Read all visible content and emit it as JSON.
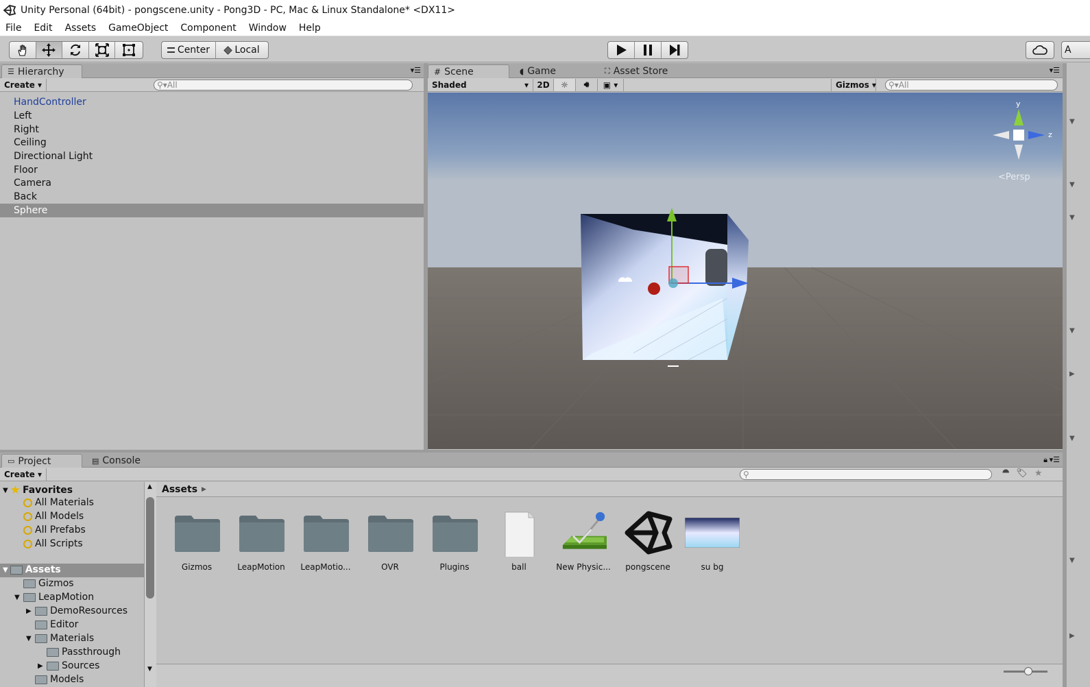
{
  "window": {
    "title": "Unity Personal (64bit) - pongscene.unity - Pong3D - PC, Mac & Linux Standalone* <DX11>"
  },
  "menu": [
    "File",
    "Edit",
    "Assets",
    "GameObject",
    "Component",
    "Window",
    "Help"
  ],
  "toolbar": {
    "pivot_label": "Center",
    "space_label": "Local",
    "partial_right": "A"
  },
  "hierarchy": {
    "tab_label": "Hierarchy",
    "create_label": "Create",
    "search_placeholder": "All",
    "items": [
      "HandController",
      "Left",
      "Right",
      "Ceiling",
      "Directional Light",
      "Floor",
      "Camera",
      "Back",
      "Sphere"
    ],
    "selected_index": 8
  },
  "scene_tabs": {
    "scene": "Scene",
    "game": "Game",
    "asset_store": "Asset Store"
  },
  "scene_toolbar": {
    "shading": "Shaded",
    "mode_2d": "2D",
    "gizmos": "Gizmos",
    "search_placeholder": "All"
  },
  "gizmo": {
    "y_label": "y",
    "z_label": "z",
    "projection": "Persp"
  },
  "bottom_tabs": {
    "project": "Project",
    "console": "Console"
  },
  "project": {
    "create_label": "Create",
    "breadcrumb": "Assets",
    "favorites_label": "Favorites",
    "favorites": [
      "All Materials",
      "All Models",
      "All Prefabs",
      "All Scripts"
    ],
    "assets_root": "Assets",
    "tree": [
      {
        "label": "Gizmos",
        "indent": 1,
        "arrow": ""
      },
      {
        "label": "LeapMotion",
        "indent": 1,
        "arrow": "down"
      },
      {
        "label": "DemoResources",
        "indent": 2,
        "arrow": "right"
      },
      {
        "label": "Editor",
        "indent": 2,
        "arrow": ""
      },
      {
        "label": "Materials",
        "indent": 2,
        "arrow": "down"
      },
      {
        "label": "Passthrough",
        "indent": 3,
        "arrow": ""
      },
      {
        "label": "Sources",
        "indent": 3,
        "arrow": "right"
      },
      {
        "label": "Models",
        "indent": 2,
        "arrow": ""
      }
    ],
    "assets": [
      {
        "label": "Gizmos",
        "kind": "folder"
      },
      {
        "label": "LeapMotion",
        "kind": "folder"
      },
      {
        "label": "LeapMotio...",
        "kind": "folder"
      },
      {
        "label": "OVR",
        "kind": "folder"
      },
      {
        "label": "Plugins",
        "kind": "folder"
      },
      {
        "label": "ball",
        "kind": "file"
      },
      {
        "label": "New Physic...",
        "kind": "physic"
      },
      {
        "label": "pongscene",
        "kind": "unity"
      },
      {
        "label": "su bg",
        "kind": "texture"
      }
    ]
  },
  "colors": {
    "selected_row": "#8f8f8f",
    "hierarchy_link": "#1f3f9a",
    "panel_bg": "#c2c2c2"
  }
}
